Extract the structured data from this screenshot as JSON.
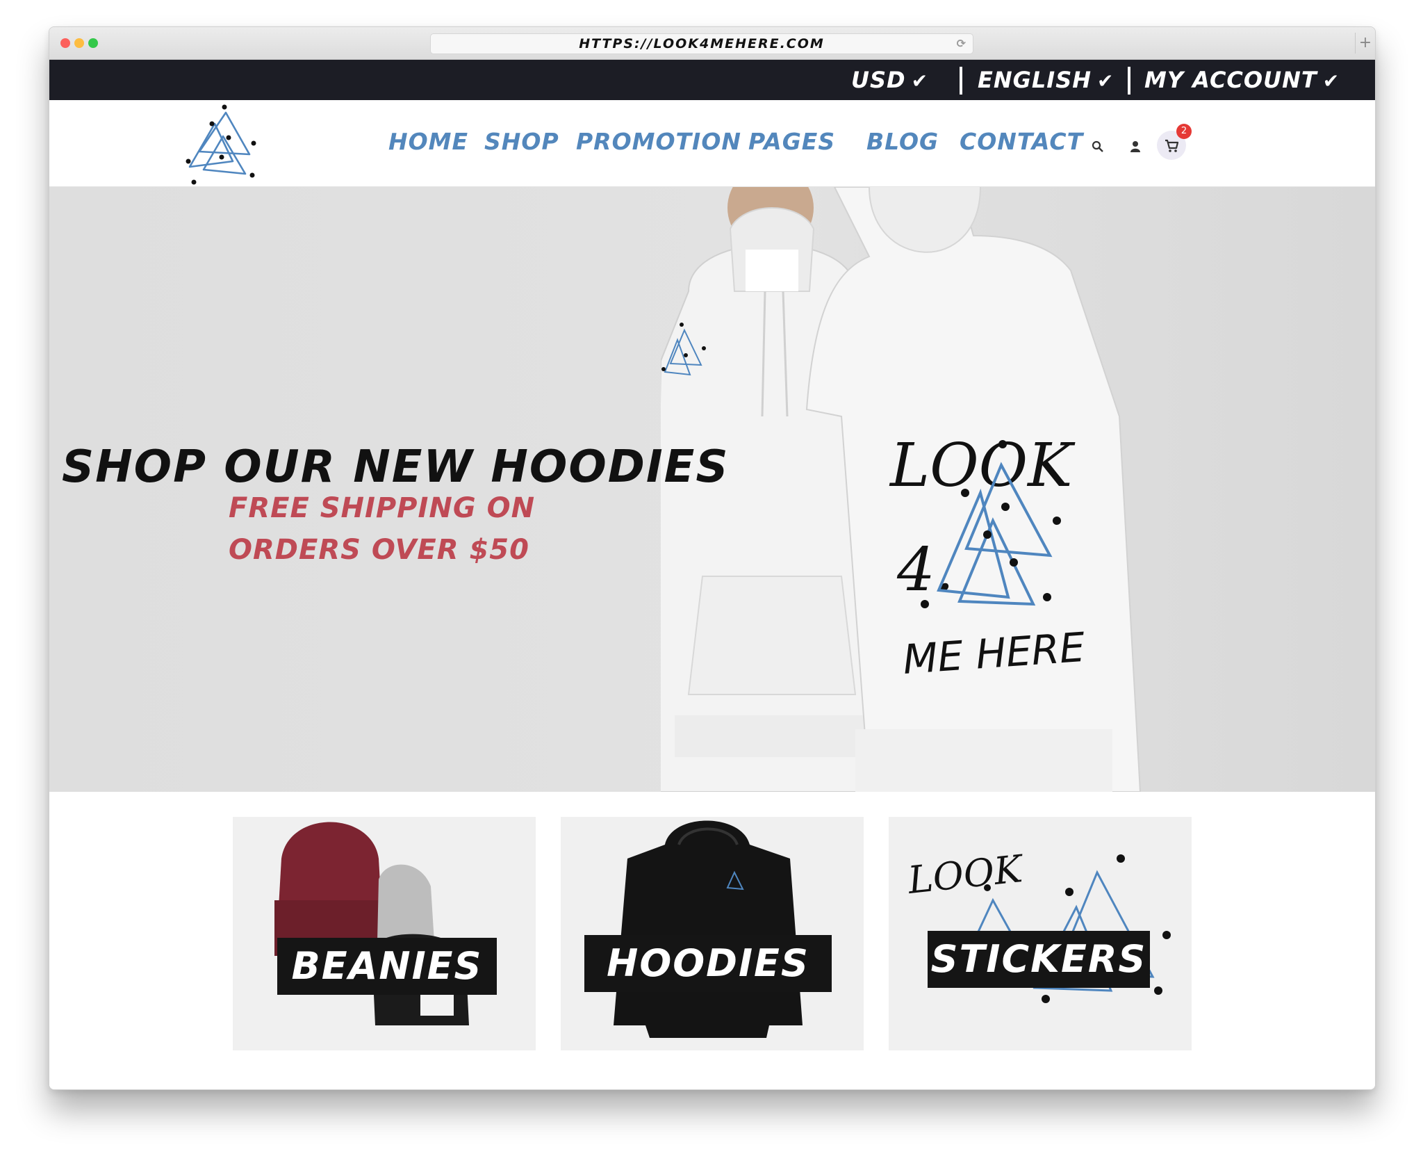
{
  "browser": {
    "url": "HTTPS://LOOK4MEHERE.COM",
    "new_tab_glyph": "+"
  },
  "topbar": {
    "currency": "USD",
    "language": "ENGLISH",
    "account": "MY ACCOUNT",
    "chevron_icon": "chevron-down-icon"
  },
  "nav": {
    "items": [
      {
        "label": "HOME"
      },
      {
        "label": "SHOP"
      },
      {
        "label": "PROMOTION"
      },
      {
        "label": "PAGES"
      },
      {
        "label": "BLOG"
      },
      {
        "label": "CONTACT"
      }
    ],
    "icons": [
      "search-icon",
      "user-icon",
      "cart-icon"
    ],
    "cart_count": "2"
  },
  "hero": {
    "headline": "SHOP OUR NEW HOODIES",
    "subline_1": "FREE SHIPPING ON",
    "subline_2": "ORDERS OVER $50",
    "back_print": [
      "LOOK",
      "4.",
      "ME HERE"
    ]
  },
  "categories": [
    {
      "label": "BEANIES"
    },
    {
      "label": "HOODIES"
    },
    {
      "label": "STICKERS"
    }
  ],
  "colors": {
    "nav_blue": "#5387bc",
    "promo_red": "#bf4a55",
    "topbar_bg": "#1c1d25",
    "badge_red": "#e53935"
  }
}
